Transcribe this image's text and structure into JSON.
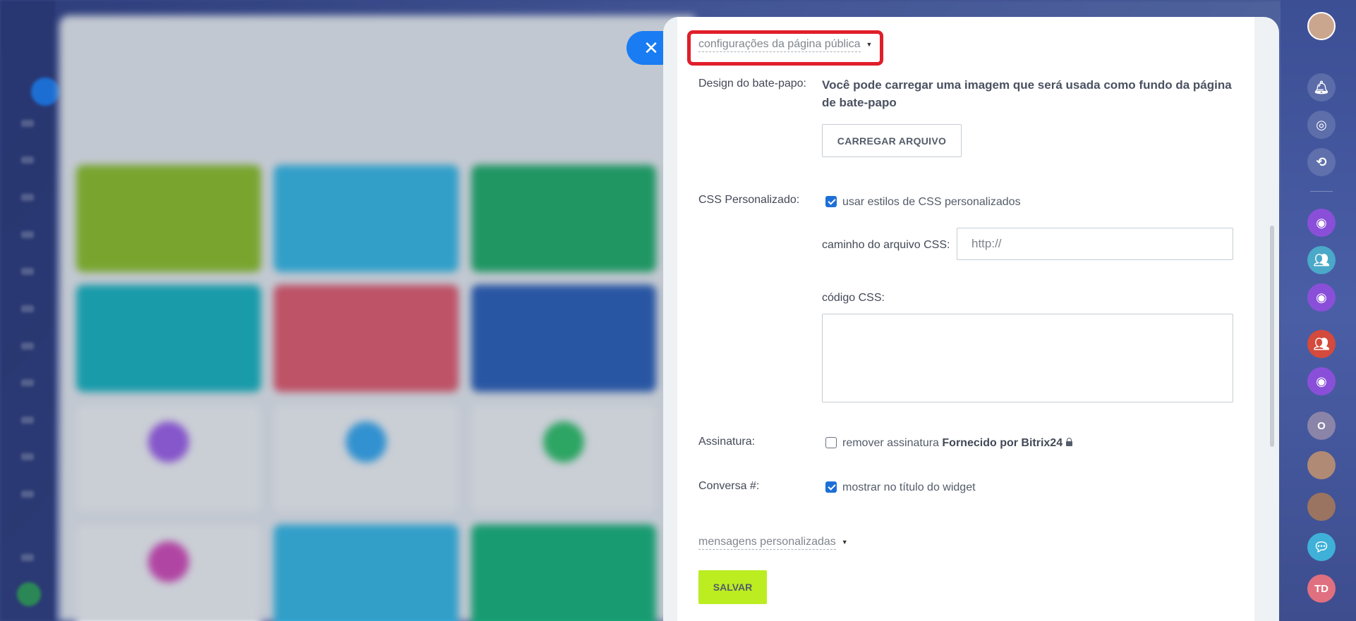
{
  "close_icon": "close-icon",
  "panel": {
    "public_page_settings": "configurações da página pública",
    "chat_design": {
      "label": "Design do bate-papo:",
      "description_line1": "Você pode carregar uma imagem que será usada como fundo da página",
      "description_line2": "de bate-papo",
      "upload_button": "CARREGAR ARQUIVO"
    },
    "custom_css": {
      "label": "CSS Personalizado:",
      "checkbox_label": "usar estilos de CSS personalizados",
      "checked": true,
      "file_path_label": "caminho do arquivo CSS:",
      "file_path_placeholder": "http://",
      "code_label": "código CSS:"
    },
    "signature": {
      "label": "Assinatura:",
      "checkbox_label": "remover assinatura",
      "brand": "Fornecido por Bitrix24",
      "checked": false
    },
    "conversation": {
      "label": "Conversa #:",
      "checkbox_label": "mostrar no título do widget",
      "checked": true
    },
    "custom_messages": "mensagens personalizadas",
    "save_button": "SALVAR"
  },
  "rightbar": {
    "avatar_initials_o": "O",
    "avatar_initials_td": "TD"
  },
  "colors": {
    "accent_blue": "#1a7cf2",
    "highlight_red": "#e01e2a",
    "save_green": "#bbed21"
  }
}
